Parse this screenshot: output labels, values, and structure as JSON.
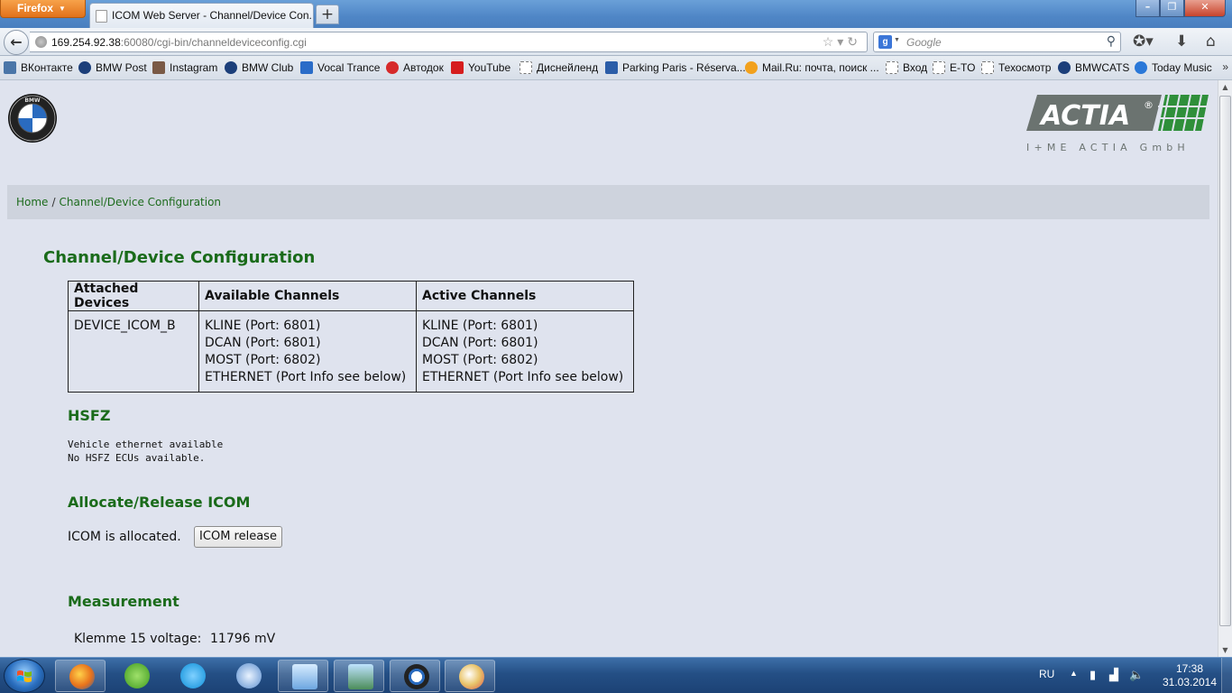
{
  "browser": {
    "app_button": "Firefox",
    "tab_title": "ICOM Web Server - Channel/Device Con...",
    "url_host": "169.254.92.38",
    "url_rest": ":60080/cgi-bin/channeldeviceconfig.cgi",
    "search_placeholder": "Google",
    "bookmarks": [
      {
        "label": "ВКонтакте",
        "icon": "vk-icon",
        "color": "#4a76a8"
      },
      {
        "label": "BMW Post",
        "icon": "bmw-icon",
        "color": "#1c3f7a"
      },
      {
        "label": "Instagram",
        "icon": "instagram-icon",
        "color": "#7a5a46"
      },
      {
        "label": "BMW Club",
        "icon": "bmw-icon",
        "color": "#1c3f7a"
      },
      {
        "label": "Vocal Trance",
        "icon": "vocal-trance-icon",
        "color": "#2a6cc8"
      },
      {
        "label": "Автодок",
        "icon": "autodoc-icon",
        "color": "#d62a2a"
      },
      {
        "label": "YouTube",
        "icon": "youtube-icon",
        "color": "#d61e1e"
      },
      {
        "label": "Диснейленд",
        "icon": "page-icon",
        "color": "#ffffff"
      },
      {
        "label": "Parking Paris - Réserva...",
        "icon": "parking-icon",
        "color": "#2b5da8"
      },
      {
        "label": "Mail.Ru: почта, поиск ...",
        "icon": "mailru-icon",
        "color": "#f2a11c"
      },
      {
        "label": "Вход",
        "icon": "page-icon",
        "color": "#ffffff"
      },
      {
        "label": "E-TO",
        "icon": "page-icon",
        "color": "#ffffff"
      },
      {
        "label": "Техосмотр",
        "icon": "page-icon",
        "color": "#ffffff"
      },
      {
        "label": "BMWCATS",
        "icon": "bmw-icon",
        "color": "#1c3f7a"
      },
      {
        "label": "Today Music",
        "icon": "today-music-icon",
        "color": "#2a78d8"
      }
    ],
    "more_bookmarks": "»"
  },
  "page": {
    "breadcrumb": {
      "home": "Home",
      "separator": "/",
      "current": "Channel/Device Configuration"
    },
    "title": "Channel/Device Configuration",
    "actia_logo": {
      "wordmark": "ACTIA",
      "tagline": "I+ME ACTIA GmbH"
    },
    "table": {
      "headers": [
        "Attached Devices",
        "Available Channels",
        "Active Channels"
      ],
      "device": "DEVICE_ICOM_B",
      "available": [
        "KLINE (Port: 6801)",
        "DCAN (Port: 6801)",
        "MOST (Port: 6802)",
        "ETHERNET (Port Info see below)"
      ],
      "active": [
        "KLINE (Port: 6801)",
        "DCAN (Port: 6801)",
        "MOST (Port: 6802)",
        "ETHERNET (Port Info see below)"
      ]
    },
    "hsfz": {
      "title": "HSFZ",
      "lines": [
        "Vehicle ethernet available",
        "No HSFZ ECUs available."
      ]
    },
    "allocate": {
      "title": "Allocate/Release ICOM",
      "status": "ICOM is allocated.",
      "button": "ICOM release"
    },
    "measurement": {
      "title": "Measurement",
      "label": "Klemme 15 voltage:",
      "value": "11796 mV"
    }
  },
  "taskbar": {
    "apps": [
      {
        "name": "firefox",
        "pinned": true
      },
      {
        "name": "utorrent",
        "pinned": false
      },
      {
        "name": "skype",
        "pinned": false
      },
      {
        "name": "itunes",
        "pinned": false
      },
      {
        "name": "control-panel",
        "pinned": true
      },
      {
        "name": "image-viewer",
        "pinned": true
      },
      {
        "name": "icom-tool",
        "pinned": true
      },
      {
        "name": "paint",
        "pinned": true
      }
    ],
    "language": "RU",
    "time": "17:38",
    "date": "31.03.2014"
  },
  "colors": {
    "heading_green": "#1a6b1a",
    "link_green": "#1d6b1d",
    "page_bg": "#dfe3ee",
    "breadcrumb_bg": "#ced3dd",
    "actia_grey": "#6b7370",
    "actia_green": "#2f8f3a"
  }
}
